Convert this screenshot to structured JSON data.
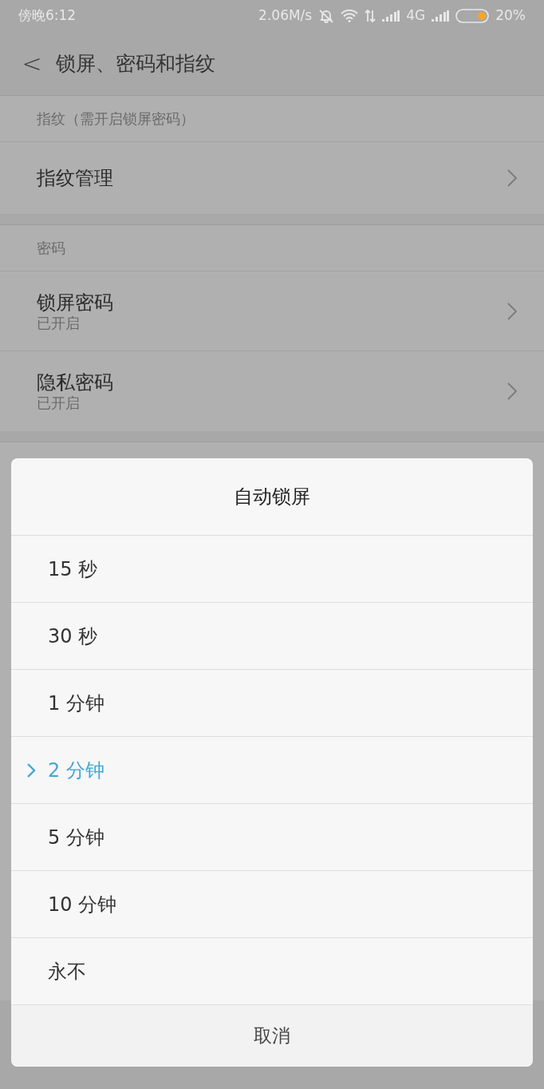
{
  "status_bar": {
    "time": "傍晚6:12",
    "speed": "2.06M/s",
    "network": "4G",
    "battery": "20%"
  },
  "header": {
    "back": "<",
    "title": "锁屏、密码和指纹"
  },
  "sections": [
    {
      "title": "指纹（需开启锁屏密码）",
      "rows": [
        {
          "label": "指纹管理"
        }
      ]
    },
    {
      "title": "密码",
      "rows": [
        {
          "label": "锁屏密码",
          "subtitle": "已开启"
        },
        {
          "label": "隐私密码",
          "subtitle": "已开启"
        }
      ]
    }
  ],
  "dialog": {
    "title": "自动锁屏",
    "options": [
      {
        "label": "15 秒",
        "selected": false
      },
      {
        "label": "30 秒",
        "selected": false
      },
      {
        "label": "1 分钟",
        "selected": false
      },
      {
        "label": "2 分钟",
        "selected": true
      },
      {
        "label": "5 分钟",
        "selected": false
      },
      {
        "label": "10 分钟",
        "selected": false
      },
      {
        "label": "永不",
        "selected": false
      }
    ],
    "cancel": "取消"
  }
}
